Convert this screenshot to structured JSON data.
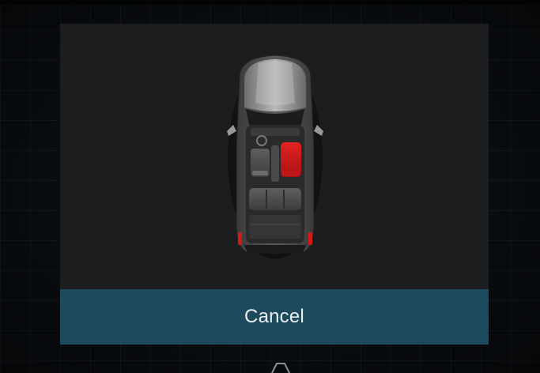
{
  "dialog": {
    "cancel_label": "Cancel"
  },
  "car": {
    "icon": "car-top-view-icon",
    "highlighted_seat": "front-passenger-seat",
    "highlight_color": "#d61b1b",
    "body_color": "#8a8a8a"
  },
  "colors": {
    "background": "#0b0f13",
    "dialog": "#1b1d1f",
    "button": "#1e4a5e"
  }
}
